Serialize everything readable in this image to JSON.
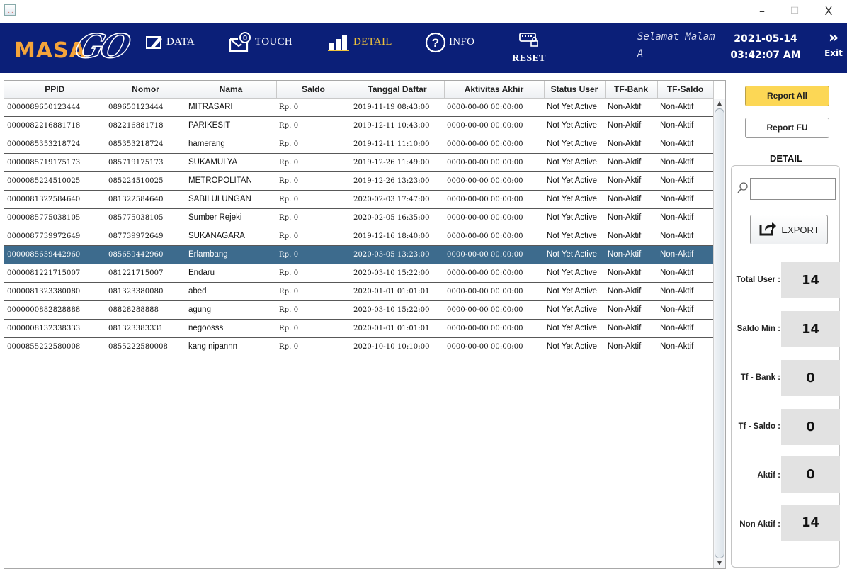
{
  "window": {
    "minimize_icon": "–",
    "maximize_icon": "☐",
    "close_icon": "X"
  },
  "header": {
    "logo_text_1": "MASA",
    "logo_text_2": "GO",
    "nav": {
      "data": "DATA",
      "touch": "TOUCH",
      "detail": "DETAIL",
      "info": "INFO",
      "reset": "RESET"
    },
    "greeting_line1": "Selamat Malam",
    "greeting_line2": "A",
    "date": "2021-05-14",
    "time": "03:42:07 AM",
    "exit_label": "Exit",
    "exit_icon": "»"
  },
  "table": {
    "columns": [
      "PPID",
      "Nomor",
      "Nama",
      "Saldo",
      "Tanggal Daftar",
      "Aktivitas Akhir",
      "Status User",
      "TF-Bank",
      "TF-Saldo"
    ],
    "selected_row": 8,
    "rows": [
      [
        "0000089650123444",
        "089650123444",
        "MITRASARI",
        "Rp. 0",
        "2019-11-19 08:43:00",
        "0000-00-00 00:00:00",
        "Not Yet Active",
        "Non-Aktif",
        "Non-Aktif"
      ],
      [
        "0000082216881718",
        "082216881718",
        "PARIKESIT",
        "Rp. 0",
        "2019-12-11 10:43:00",
        "0000-00-00 00:00:00",
        "Not Yet Active",
        "Non-Aktif",
        "Non-Aktif"
      ],
      [
        "0000085353218724",
        "085353218724",
        "hamerang",
        "Rp. 0",
        "2019-12-11 11:10:00",
        "0000-00-00 00:00:00",
        "Not Yet Active",
        "Non-Aktif",
        "Non-Aktif"
      ],
      [
        "0000085719175173",
        "085719175173",
        "SUKAMULYA",
        "Rp. 0",
        "2019-12-26 11:49:00",
        "0000-00-00 00:00:00",
        "Not Yet Active",
        "Non-Aktif",
        "Non-Aktif"
      ],
      [
        "0000085224510025",
        "085224510025",
        "METROPOLITAN",
        "Rp. 0",
        "2019-12-26 13:23:00",
        "0000-00-00 00:00:00",
        "Not Yet Active",
        "Non-Aktif",
        "Non-Aktif"
      ],
      [
        "0000081322584640",
        "081322584640",
        "SABILULUNGAN",
        "Rp. 0",
        "2020-02-03 17:47:00",
        "0000-00-00 00:00:00",
        "Not Yet Active",
        "Non-Aktif",
        "Non-Aktif"
      ],
      [
        "0000085775038105",
        "085775038105",
        "Sumber Rejeki",
        "Rp. 0",
        "2020-02-05 16:35:00",
        "0000-00-00 00:00:00",
        "Not Yet Active",
        "Non-Aktif",
        "Non-Aktif"
      ],
      [
        "0000087739972649",
        "087739972649",
        "SUKANAGARA",
        "Rp. 0",
        "2019-12-16 18:40:00",
        "0000-00-00 00:00:00",
        "Not Yet Active",
        "Non-Aktif",
        "Non-Aktif"
      ],
      [
        "0000085659442960",
        "085659442960",
        "Erlambang",
        "Rp. 0",
        "2020-03-05 13:23:00",
        "0000-00-00 00:00:00",
        "Not Yet Active",
        "Non-Aktif",
        "Non-Aktif"
      ],
      [
        "0000081221715007",
        "081221715007",
        "Endaru",
        "Rp. 0",
        "2020-03-10 15:22:00",
        "0000-00-00 00:00:00",
        "Not Yet Active",
        "Non-Aktif",
        "Non-Aktif"
      ],
      [
        "0000081323380080",
        "081323380080",
        "abed",
        "Rp. 0",
        "2020-01-01 01:01:01",
        "0000-00-00 00:00:00",
        "Not Yet Active",
        "Non-Aktif",
        "Non-Aktif"
      ],
      [
        "0000000882828888",
        "08828288888",
        "agung",
        "Rp. 0",
        "2020-03-10 15:22:00",
        "0000-00-00 00:00:00",
        "Not Yet Active",
        "Non-Aktif",
        "Non-Aktif"
      ],
      [
        "0000008132338333",
        "081323383331",
        "negoosss",
        "Rp. 0",
        "2020-01-01 01:01:01",
        "0000-00-00 00:00:00",
        "Not Yet Active",
        "Non-Aktif",
        "Non-Aktif"
      ],
      [
        "0000855222580008",
        "0855222580008",
        "kang nipannn",
        "Rp. 0",
        "2020-10-10 10:10:00",
        "0000-00-00 00:00:00",
        "Not Yet Active",
        "Non-Aktif",
        "Non-Aktif"
      ]
    ]
  },
  "panel": {
    "report_all": "Report All",
    "report_fu": "Report FU",
    "detail_title": "DETAIL",
    "search_value": "",
    "export_label": "EXPORT",
    "stats": [
      {
        "label": "Total User :",
        "value": "14"
      },
      {
        "label": "Saldo Min :",
        "value": "14"
      },
      {
        "label": "Tf - Bank :",
        "value": "0"
      },
      {
        "label": "Tf - Saldo :",
        "value": "0"
      },
      {
        "label": "Aktif :",
        "value": "0"
      },
      {
        "label": "Non Aktif :",
        "value": "14"
      }
    ]
  },
  "colors": {
    "header_bg": "#0b1f78",
    "logo_orange": "#f5a43a",
    "active_nav": "#f0c23b",
    "selected_row": "#3d6b8d",
    "report_all_bg": "#fcd755"
  }
}
